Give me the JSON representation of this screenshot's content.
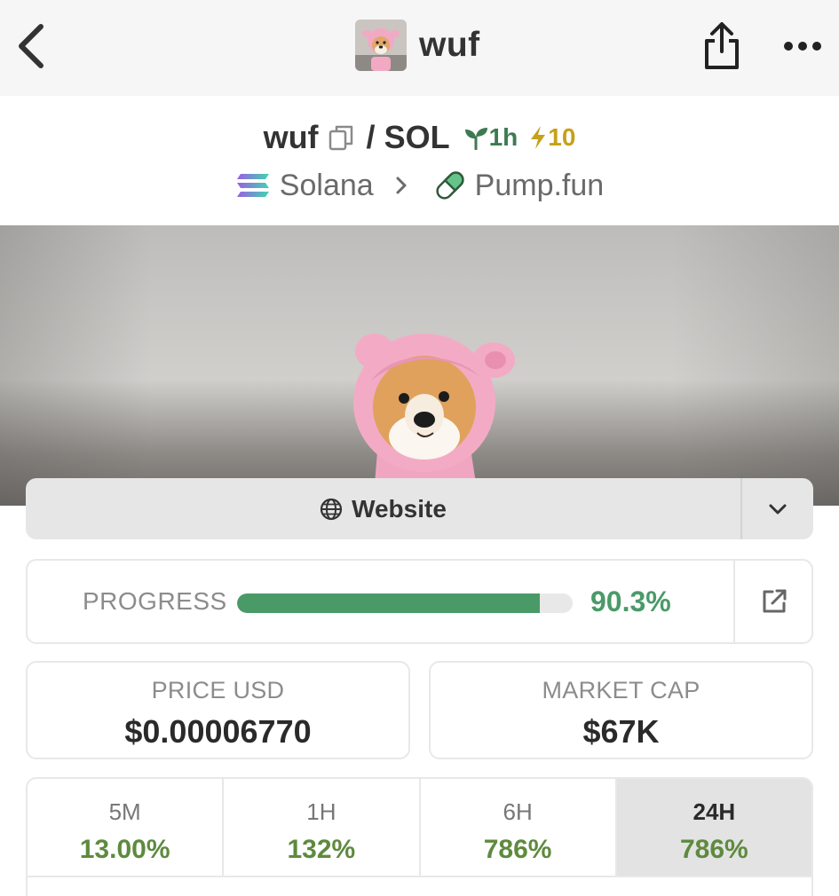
{
  "nav": {
    "title": "wuf"
  },
  "pair": {
    "base": "wuf",
    "separator": "/",
    "quote": "SOL",
    "age": "1h",
    "boosts": "10"
  },
  "chain": {
    "network": "Solana",
    "dex": "Pump.fun"
  },
  "links": {
    "website_label": "Website"
  },
  "progress": {
    "label": "PROGRESS",
    "value_text": "90.3%",
    "fraction": 0.903
  },
  "stats": {
    "price_label": "PRICE USD",
    "price_value": "$0.00006770",
    "mcap_label": "MARKET CAP",
    "mcap_value": "$67K"
  },
  "timeframes": [
    {
      "label": "5M",
      "change": "13.00%"
    },
    {
      "label": "1H",
      "change": "132%"
    },
    {
      "label": "6H",
      "change": "786%"
    },
    {
      "label": "24H",
      "change": "786%"
    }
  ],
  "colors": {
    "accent_green": "#4a9a68",
    "change_green": "#5e8a3e",
    "boost_gold": "#c6a119",
    "age_green": "#3d7a52"
  },
  "icons": {
    "back": "chevron-left-icon",
    "share": "share-icon",
    "more": "more-horizontal-icon",
    "copy": "copy-icon",
    "age": "seedling-icon",
    "boost": "lightning-icon",
    "network": "solana-logo",
    "dex": "pill-icon",
    "website": "globe-icon",
    "caret": "chevron-down-icon",
    "external": "external-link-icon"
  }
}
